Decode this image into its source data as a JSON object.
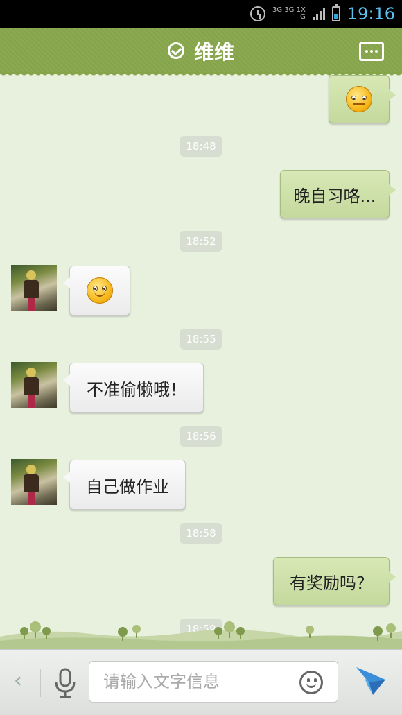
{
  "status_bar": {
    "time": "19:16",
    "network_top": "3G 3G 1X",
    "network_bottom": "G",
    "accent": "#5ac0ee"
  },
  "header": {
    "title": "维维",
    "verified_icon": "check-circle-icon",
    "menu_icon": "more-menu-icon",
    "color": "#86a54b"
  },
  "messages": [
    {
      "type": "sticker",
      "direction": "out",
      "icon": "meh-emoji-icon"
    },
    {
      "type": "time",
      "text": "18:48"
    },
    {
      "type": "text",
      "direction": "out",
      "text": "晚自习咯..."
    },
    {
      "type": "time",
      "text": "18:52"
    },
    {
      "type": "sticker",
      "direction": "in",
      "icon": "smile-emoji-icon"
    },
    {
      "type": "time",
      "text": "18:55"
    },
    {
      "type": "text",
      "direction": "in",
      "text": "不准偷懒哦！"
    },
    {
      "type": "time",
      "text": "18:56"
    },
    {
      "type": "text",
      "direction": "in",
      "text": "自己做作业"
    },
    {
      "type": "time",
      "text": "18:58"
    },
    {
      "type": "text",
      "direction": "out",
      "text": "有奖励吗？"
    },
    {
      "type": "time",
      "text": "18:59"
    }
  ],
  "input_bar": {
    "placeholder": "请输入文字信息",
    "back_icon": "chevron-left-icon",
    "voice_icon": "microphone-icon",
    "emoji_icon": "smiley-icon",
    "send_icon": "send-icon"
  },
  "colors": {
    "chat_background": "#e8f0de",
    "outgoing_bubble": "#c4d99d",
    "incoming_bubble": "#f5f5f5"
  }
}
